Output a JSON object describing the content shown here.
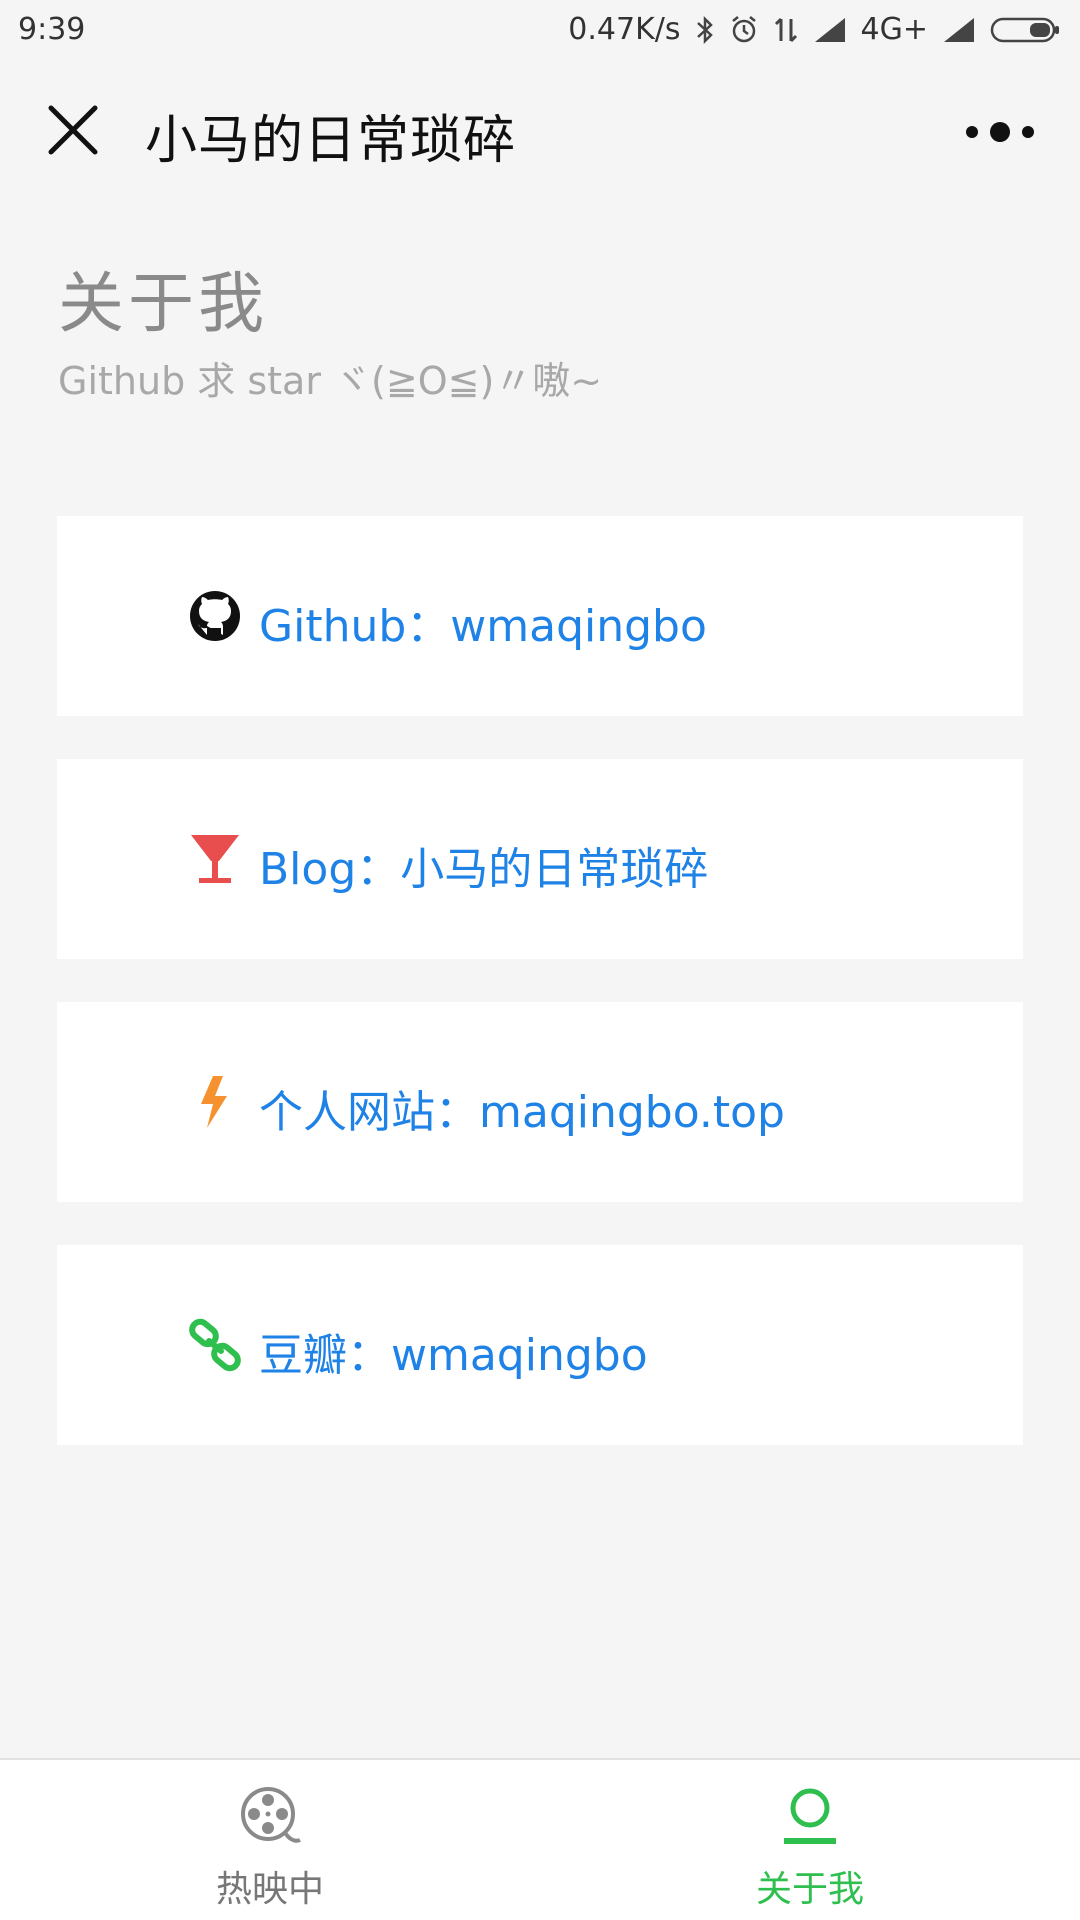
{
  "status_bar": {
    "time": "9:39",
    "network_speed": "0.47K/s",
    "network_type": "4G+",
    "icons": [
      "bluetooth-icon",
      "alarm-icon",
      "data-transfer-icon",
      "signal-icon",
      "signal-icon",
      "battery-icon"
    ]
  },
  "nav": {
    "title": "小马的日常琐碎",
    "close_icon": "close-icon",
    "more_icon": "more-icon"
  },
  "header": {
    "title": "关于我",
    "subtitle": "Github 求 star ヾ(≧O≦)〃嗷~"
  },
  "links": [
    {
      "label": "Github：wmaqingbo",
      "icon": "github-icon",
      "icon_color": "#111111"
    },
    {
      "label": "Blog：小马的日常琐碎",
      "icon": "cocktail-icon",
      "icon_color": "#e94e4e"
    },
    {
      "label": "个人网站：maqingbo.top",
      "icon": "lightning-icon",
      "icon_color": "#f5922f"
    },
    {
      "label": "豆瓣：wmaqingbo",
      "icon": "link-icon",
      "icon_color": "#2fbf4f"
    }
  ],
  "tab_bar": {
    "tabs": [
      {
        "label": "热映中",
        "icon": "film-reel-icon",
        "active": false
      },
      {
        "label": "关于我",
        "icon": "user-icon",
        "active": true
      }
    ]
  },
  "colors": {
    "link_text": "#1e82e6",
    "active_tab": "#2fbf4f",
    "background": "#f5f5f5"
  }
}
